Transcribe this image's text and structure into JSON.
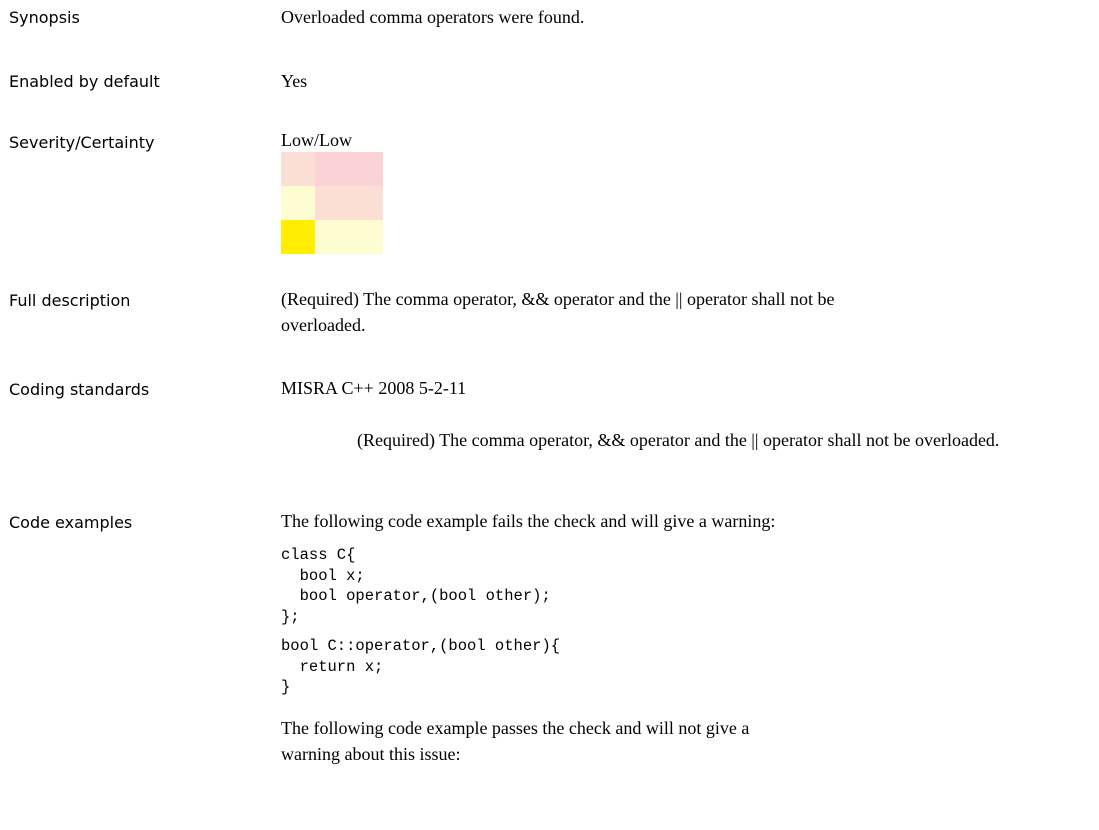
{
  "rows": {
    "synopsis": {
      "label": "Synopsis",
      "value": "Overloaded comma operators were found."
    },
    "enabled": {
      "label": "Enabled by default",
      "value": "Yes"
    },
    "severity": {
      "label": "Severity/Certainty",
      "value": "Low/Low",
      "matrix_colors": [
        [
          "#fbdfd4",
          "#fbd2d6",
          "#fbd2d6"
        ],
        [
          "#fefdd2",
          "#fbdfd4",
          "#fbdfd4"
        ],
        [
          "#ffee00",
          "#fefdd2",
          "#fefdd2"
        ]
      ]
    },
    "full_description": {
      "label": "Full description",
      "value": "(Required) The comma operator, && operator and the || operator shall not be overloaded."
    },
    "coding_standards": {
      "label": "Coding standards",
      "standard": "MISRA C++ 2008 5-2-11",
      "detail": "(Required) The comma operator, && operator and the || operator shall not be overloaded."
    },
    "code_examples": {
      "label": "Code examples",
      "fail_intro": "The following code example fails the check and will give a warning:",
      "code_block_1": "class C{\n  bool x;\n  bool operator,(bool other);\n};",
      "code_block_2": "bool C::operator,(bool other){\n  return x;\n}",
      "pass_intro": "The following code example passes the check and will not give a warning about this issue:"
    }
  }
}
